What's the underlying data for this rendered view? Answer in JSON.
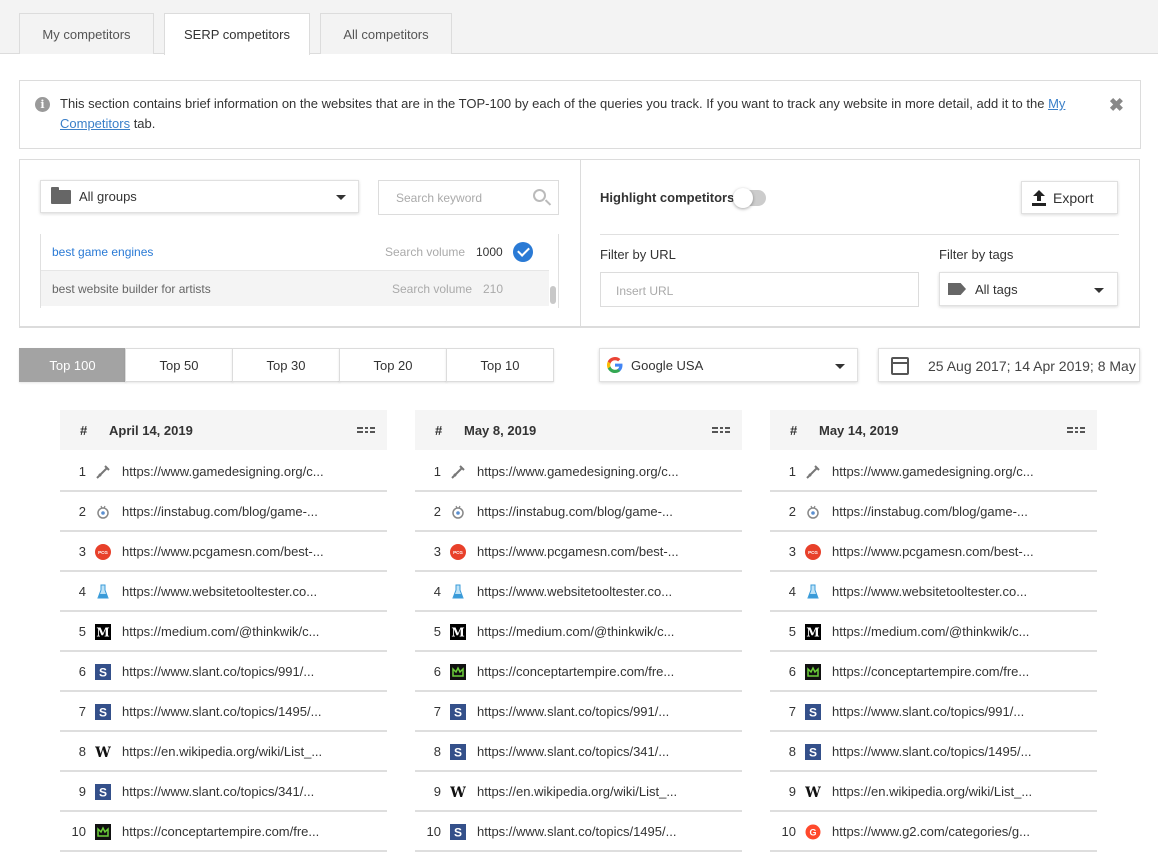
{
  "tabs": [
    {
      "label": "My competitors"
    },
    {
      "label": "SERP competitors"
    },
    {
      "label": "All competitors"
    }
  ],
  "info": {
    "text_before": "This section contains brief information on the websites that are in the TOP-100 by each of the queries you track. If you want to track any website in more detail, add it to the ",
    "link": "My Competitors",
    "text_after": " tab.",
    "close": "✖"
  },
  "groups": {
    "selected": "All groups"
  },
  "search": {
    "placeholder": "Search keyword"
  },
  "keywords": [
    {
      "keyword": "best game engines",
      "sv_label": "Search volume",
      "sv": "1000",
      "selected": true
    },
    {
      "keyword": "best website builder for artists",
      "sv_label": "Search volume",
      "sv": "210",
      "selected": false
    }
  ],
  "highlight": {
    "label": "Highlight competitors",
    "on": false
  },
  "export": {
    "label": "Export"
  },
  "filter_url": {
    "label": "Filter by URL",
    "placeholder": "Insert URL"
  },
  "filter_tags": {
    "label": "Filter by tags",
    "selected": "All tags"
  },
  "top_buttons": [
    "Top 100",
    "Top 50",
    "Top 30",
    "Top 20",
    "Top 10"
  ],
  "engine": {
    "selected": "Google USA"
  },
  "dates": {
    "value": "25 Aug 2017; 14 Apr 2019; 8 May"
  },
  "accent": "#2a7ad5",
  "columns": [
    {
      "hash": "#",
      "date": "April 14, 2019",
      "rows": [
        {
          "n": "1",
          "icon": "gamedesigning",
          "url": "https://www.gamedesigning.org/c..."
        },
        {
          "n": "2",
          "icon": "instabug",
          "url": "https://instabug.com/blog/game-..."
        },
        {
          "n": "3",
          "icon": "pcgamesn",
          "url": "https://www.pcgamesn.com/best-..."
        },
        {
          "n": "4",
          "icon": "websitetooltester",
          "url": "https://www.websitetooltester.co..."
        },
        {
          "n": "5",
          "icon": "medium",
          "url": "https://medium.com/@thinkwik/c..."
        },
        {
          "n": "6",
          "icon": "slant",
          "url": "https://www.slant.co/topics/991/..."
        },
        {
          "n": "7",
          "icon": "slant",
          "url": "https://www.slant.co/topics/1495/..."
        },
        {
          "n": "8",
          "icon": "wikipedia",
          "url": "https://en.wikipedia.org/wiki/List_..."
        },
        {
          "n": "9",
          "icon": "slant",
          "url": "https://www.slant.co/topics/341/..."
        },
        {
          "n": "10",
          "icon": "conceptartempire",
          "url": "https://conceptartempire.com/fre..."
        }
      ]
    },
    {
      "hash": "#",
      "date": "May 8, 2019",
      "rows": [
        {
          "n": "1",
          "icon": "gamedesigning",
          "url": "https://www.gamedesigning.org/c..."
        },
        {
          "n": "2",
          "icon": "instabug",
          "url": "https://instabug.com/blog/game-..."
        },
        {
          "n": "3",
          "icon": "pcgamesn",
          "url": "https://www.pcgamesn.com/best-..."
        },
        {
          "n": "4",
          "icon": "websitetooltester",
          "url": "https://www.websitetooltester.co..."
        },
        {
          "n": "5",
          "icon": "medium",
          "url": "https://medium.com/@thinkwik/c..."
        },
        {
          "n": "6",
          "icon": "conceptartempire",
          "url": "https://conceptartempire.com/fre..."
        },
        {
          "n": "7",
          "icon": "slant",
          "url": "https://www.slant.co/topics/991/..."
        },
        {
          "n": "8",
          "icon": "slant",
          "url": "https://www.slant.co/topics/341/..."
        },
        {
          "n": "9",
          "icon": "wikipedia",
          "url": "https://en.wikipedia.org/wiki/List_..."
        },
        {
          "n": "10",
          "icon": "slant",
          "url": "https://www.slant.co/topics/1495/..."
        }
      ]
    },
    {
      "hash": "#",
      "date": "May 14, 2019",
      "rows": [
        {
          "n": "1",
          "icon": "gamedesigning",
          "url": "https://www.gamedesigning.org/c..."
        },
        {
          "n": "2",
          "icon": "instabug",
          "url": "https://instabug.com/blog/game-..."
        },
        {
          "n": "3",
          "icon": "pcgamesn",
          "url": "https://www.pcgamesn.com/best-..."
        },
        {
          "n": "4",
          "icon": "websitetooltester",
          "url": "https://www.websitetooltester.co..."
        },
        {
          "n": "5",
          "icon": "medium",
          "url": "https://medium.com/@thinkwik/c..."
        },
        {
          "n": "6",
          "icon": "conceptartempire",
          "url": "https://conceptartempire.com/fre..."
        },
        {
          "n": "7",
          "icon": "slant",
          "url": "https://www.slant.co/topics/991/..."
        },
        {
          "n": "8",
          "icon": "slant",
          "url": "https://www.slant.co/topics/1495/..."
        },
        {
          "n": "9",
          "icon": "wikipedia",
          "url": "https://en.wikipedia.org/wiki/List_..."
        },
        {
          "n": "10",
          "icon": "g2",
          "url": "https://www.g2.com/categories/g..."
        }
      ]
    }
  ]
}
